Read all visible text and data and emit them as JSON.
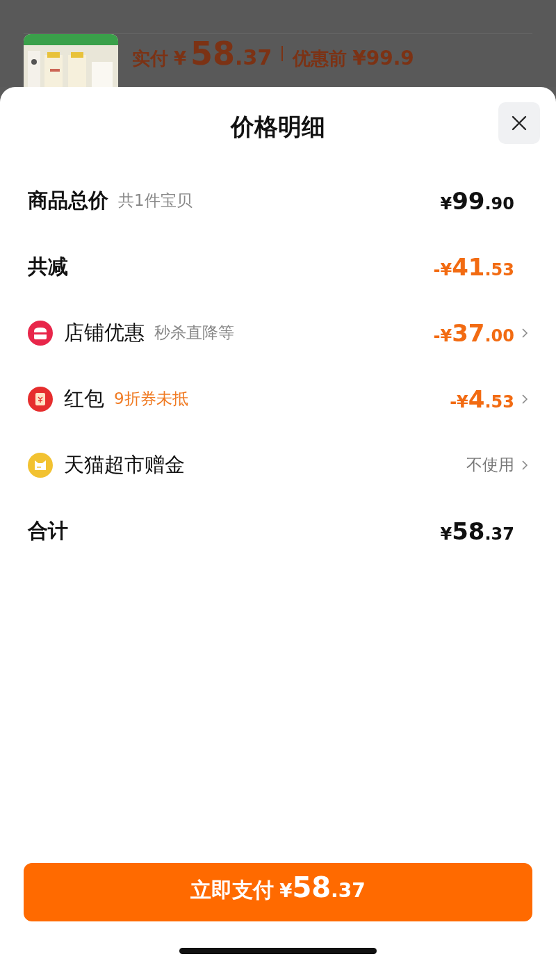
{
  "background": {
    "paid_label": "实付",
    "paid_price": {
      "currency": "¥",
      "integer": "58",
      "decimal": ".37"
    },
    "original_label": "优惠前",
    "original_price": "¥99.9"
  },
  "sheet": {
    "title": "价格明细",
    "rows": [
      {
        "kind": "subtotal",
        "label": "商品总价",
        "note": "共1件宝贝",
        "note_highlighted": false,
        "price": {
          "currency": "¥",
          "integer": "99",
          "decimal": ".90"
        },
        "chevron": false
      },
      {
        "kind": "discount",
        "label": "共减",
        "price": {
          "currency": "-¥",
          "integer": "41",
          "decimal": ".53"
        },
        "chevron": false
      },
      {
        "kind": "shop",
        "color": "#e8264a",
        "label": "店铺优惠",
        "note": "秒杀直降等",
        "note_highlighted": false,
        "price": {
          "currency": "-¥",
          "integer": "37",
          "decimal": ".00"
        },
        "chevron": true
      },
      {
        "kind": "coupon",
        "color": "#e62d2d",
        "label": "红包",
        "note": "9折券未抵",
        "note_highlighted": true,
        "price": {
          "currency": "-¥",
          "integer": "4",
          "decimal": ".53"
        },
        "chevron": true
      },
      {
        "kind": "allowance",
        "color": "#f2c231",
        "label": "天猫超市赠金",
        "value": "不使用",
        "chevron": true
      },
      {
        "kind": "total",
        "label": "合计",
        "price": {
          "currency": "¥",
          "integer": "58",
          "decimal": ".37"
        },
        "chevron": false
      }
    ],
    "pay_button": {
      "label": "立即支付",
      "price": {
        "currency": "¥",
        "integer": "58",
        "decimal": ".37"
      }
    }
  }
}
